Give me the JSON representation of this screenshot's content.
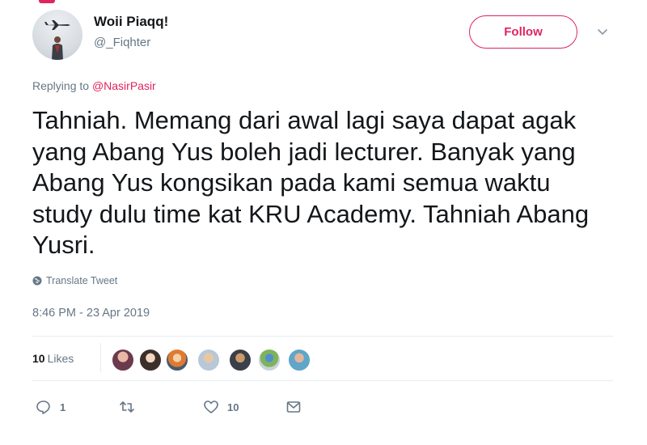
{
  "author": {
    "display_name": "Woii Piaqq!",
    "handle": "@_Fiqhter"
  },
  "follow_button": {
    "label": "Follow"
  },
  "reply_context": {
    "prefix": "Replying to ",
    "mention": "@NasirPasir"
  },
  "tweet": {
    "text": "Tahniah. Memang dari awal lagi saya dapat agak yang Abang Yus boleh jadi lecturer. Banyak yang Abang Yus kongsikan pada kami semua waktu study dulu time kat KRU Academy. Tahniah Abang Yusri.",
    "translate_label": "Translate Tweet",
    "timestamp": "8:46 PM - 23 Apr 2019"
  },
  "likes": {
    "count": "10",
    "label": "Likes"
  },
  "actions": {
    "reply_count": "1",
    "retweet_count": "",
    "like_count": "10"
  },
  "icons": [
    "caret-down-icon",
    "globe-icon",
    "reply-icon",
    "retweet-icon",
    "heart-icon",
    "message-icon"
  ],
  "colors": {
    "accent": "#e0245e",
    "secondary_text": "#657786",
    "primary_text": "#14171a"
  }
}
